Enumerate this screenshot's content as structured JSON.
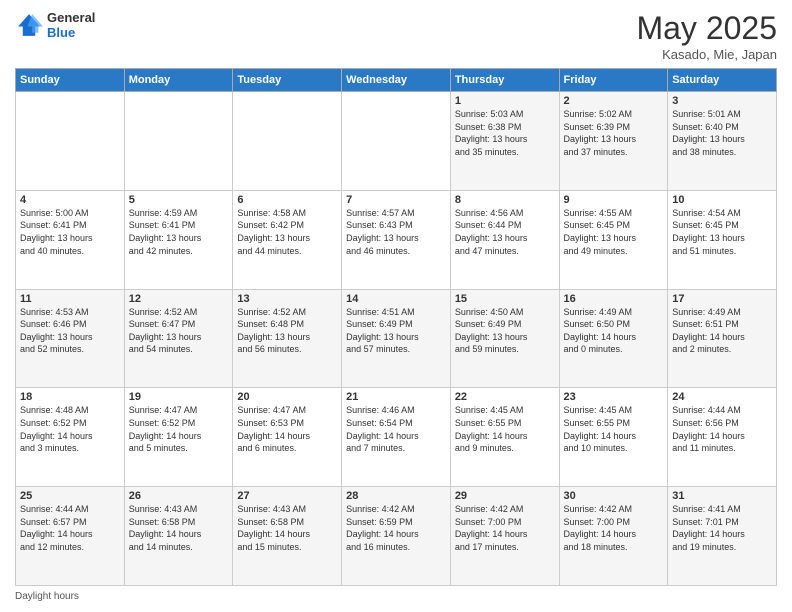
{
  "header": {
    "logo_general": "General",
    "logo_blue": "Blue",
    "month_title": "May 2025",
    "location": "Kasado, Mie, Japan"
  },
  "days_of_week": [
    "Sunday",
    "Monday",
    "Tuesday",
    "Wednesday",
    "Thursday",
    "Friday",
    "Saturday"
  ],
  "footer": {
    "daylight_label": "Daylight hours"
  },
  "weeks": [
    [
      {
        "num": "",
        "info": ""
      },
      {
        "num": "",
        "info": ""
      },
      {
        "num": "",
        "info": ""
      },
      {
        "num": "",
        "info": ""
      },
      {
        "num": "1",
        "info": "Sunrise: 5:03 AM\nSunset: 6:38 PM\nDaylight: 13 hours\nand 35 minutes."
      },
      {
        "num": "2",
        "info": "Sunrise: 5:02 AM\nSunset: 6:39 PM\nDaylight: 13 hours\nand 37 minutes."
      },
      {
        "num": "3",
        "info": "Sunrise: 5:01 AM\nSunset: 6:40 PM\nDaylight: 13 hours\nand 38 minutes."
      }
    ],
    [
      {
        "num": "4",
        "info": "Sunrise: 5:00 AM\nSunset: 6:41 PM\nDaylight: 13 hours\nand 40 minutes."
      },
      {
        "num": "5",
        "info": "Sunrise: 4:59 AM\nSunset: 6:41 PM\nDaylight: 13 hours\nand 42 minutes."
      },
      {
        "num": "6",
        "info": "Sunrise: 4:58 AM\nSunset: 6:42 PM\nDaylight: 13 hours\nand 44 minutes."
      },
      {
        "num": "7",
        "info": "Sunrise: 4:57 AM\nSunset: 6:43 PM\nDaylight: 13 hours\nand 46 minutes."
      },
      {
        "num": "8",
        "info": "Sunrise: 4:56 AM\nSunset: 6:44 PM\nDaylight: 13 hours\nand 47 minutes."
      },
      {
        "num": "9",
        "info": "Sunrise: 4:55 AM\nSunset: 6:45 PM\nDaylight: 13 hours\nand 49 minutes."
      },
      {
        "num": "10",
        "info": "Sunrise: 4:54 AM\nSunset: 6:45 PM\nDaylight: 13 hours\nand 51 minutes."
      }
    ],
    [
      {
        "num": "11",
        "info": "Sunrise: 4:53 AM\nSunset: 6:46 PM\nDaylight: 13 hours\nand 52 minutes."
      },
      {
        "num": "12",
        "info": "Sunrise: 4:52 AM\nSunset: 6:47 PM\nDaylight: 13 hours\nand 54 minutes."
      },
      {
        "num": "13",
        "info": "Sunrise: 4:52 AM\nSunset: 6:48 PM\nDaylight: 13 hours\nand 56 minutes."
      },
      {
        "num": "14",
        "info": "Sunrise: 4:51 AM\nSunset: 6:49 PM\nDaylight: 13 hours\nand 57 minutes."
      },
      {
        "num": "15",
        "info": "Sunrise: 4:50 AM\nSunset: 6:49 PM\nDaylight: 13 hours\nand 59 minutes."
      },
      {
        "num": "16",
        "info": "Sunrise: 4:49 AM\nSunset: 6:50 PM\nDaylight: 14 hours\nand 0 minutes."
      },
      {
        "num": "17",
        "info": "Sunrise: 4:49 AM\nSunset: 6:51 PM\nDaylight: 14 hours\nand 2 minutes."
      }
    ],
    [
      {
        "num": "18",
        "info": "Sunrise: 4:48 AM\nSunset: 6:52 PM\nDaylight: 14 hours\nand 3 minutes."
      },
      {
        "num": "19",
        "info": "Sunrise: 4:47 AM\nSunset: 6:52 PM\nDaylight: 14 hours\nand 5 minutes."
      },
      {
        "num": "20",
        "info": "Sunrise: 4:47 AM\nSunset: 6:53 PM\nDaylight: 14 hours\nand 6 minutes."
      },
      {
        "num": "21",
        "info": "Sunrise: 4:46 AM\nSunset: 6:54 PM\nDaylight: 14 hours\nand 7 minutes."
      },
      {
        "num": "22",
        "info": "Sunrise: 4:45 AM\nSunset: 6:55 PM\nDaylight: 14 hours\nand 9 minutes."
      },
      {
        "num": "23",
        "info": "Sunrise: 4:45 AM\nSunset: 6:55 PM\nDaylight: 14 hours\nand 10 minutes."
      },
      {
        "num": "24",
        "info": "Sunrise: 4:44 AM\nSunset: 6:56 PM\nDaylight: 14 hours\nand 11 minutes."
      }
    ],
    [
      {
        "num": "25",
        "info": "Sunrise: 4:44 AM\nSunset: 6:57 PM\nDaylight: 14 hours\nand 12 minutes."
      },
      {
        "num": "26",
        "info": "Sunrise: 4:43 AM\nSunset: 6:58 PM\nDaylight: 14 hours\nand 14 minutes."
      },
      {
        "num": "27",
        "info": "Sunrise: 4:43 AM\nSunset: 6:58 PM\nDaylight: 14 hours\nand 15 minutes."
      },
      {
        "num": "28",
        "info": "Sunrise: 4:42 AM\nSunset: 6:59 PM\nDaylight: 14 hours\nand 16 minutes."
      },
      {
        "num": "29",
        "info": "Sunrise: 4:42 AM\nSunset: 7:00 PM\nDaylight: 14 hours\nand 17 minutes."
      },
      {
        "num": "30",
        "info": "Sunrise: 4:42 AM\nSunset: 7:00 PM\nDaylight: 14 hours\nand 18 minutes."
      },
      {
        "num": "31",
        "info": "Sunrise: 4:41 AM\nSunset: 7:01 PM\nDaylight: 14 hours\nand 19 minutes."
      }
    ]
  ]
}
